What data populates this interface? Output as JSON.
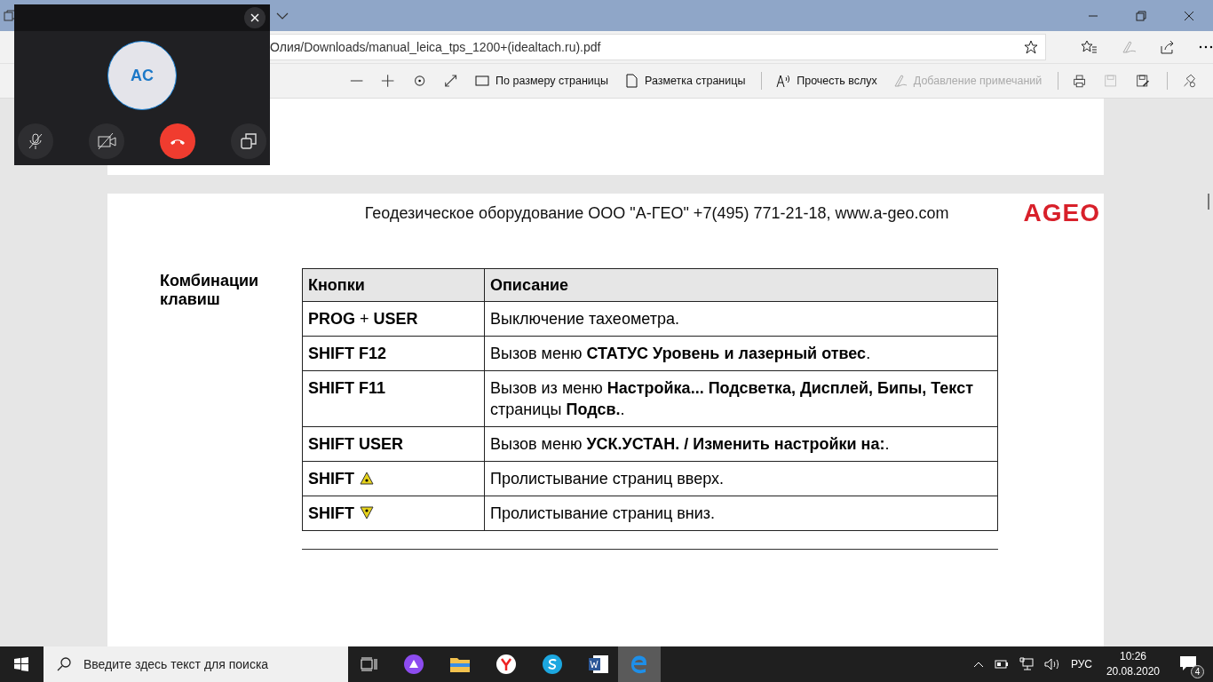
{
  "address_bar": {
    "url": "Олия/Downloads/manual_leica_tps_1200+(idealtach.ru).pdf"
  },
  "pdf_toolbar": {
    "items": [
      {
        "kind": "fit",
        "label": "По размеру страницы",
        "disabled": false
      },
      {
        "kind": "layout",
        "label": "Разметка страницы",
        "disabled": false
      },
      {
        "kind": "read",
        "label": "Прочесть вслух",
        "disabled": false
      },
      {
        "kind": "note",
        "label": "Добавление примечаний",
        "disabled": true
      }
    ]
  },
  "page": {
    "header": "Геодезическое оборудование ООО \"А-ГЕО\" +7(495) 771-21-18, www.a-geo.com",
    "logo": "AGEO",
    "side_title": "Комбинации клавиш",
    "table": {
      "columns": [
        "Кнопки",
        "Описание"
      ],
      "rows": [
        {
          "key": "**PROG** + **USER**",
          "kind": "plain",
          "description": "Выключение тахеометра."
        },
        {
          "key": "**SHIFT F12**",
          "kind": "plain",
          "description": "Вызов меню **СТАТУС Уровень и лазерный отвес**."
        },
        {
          "key": "**SHIFT F11**",
          "kind": "plain",
          "description": "Вызов из меню **Настройка... Подсветка, Дисплей, Бипы, Текст** страницы **Подсв.**."
        },
        {
          "key": "**SHIFT USER**",
          "kind": "plain",
          "description": "Вызов меню **УСК.УСТАН. / Изменить настройки на:**."
        },
        {
          "key": "**SHIFT**",
          "kind": "up",
          "description": "Пролистывание страниц вверх."
        },
        {
          "key": "**SHIFT**",
          "kind": "down",
          "description": "Пролистывание страниц вниз."
        }
      ]
    }
  },
  "call": {
    "initials": "AC",
    "muted": true,
    "video_off": true
  },
  "taskbar": {
    "search_placeholder": "Введите здесь текст для поиска",
    "language": "РУС",
    "time": "10:26",
    "date": "20.08.2020",
    "notifications": "4"
  }
}
